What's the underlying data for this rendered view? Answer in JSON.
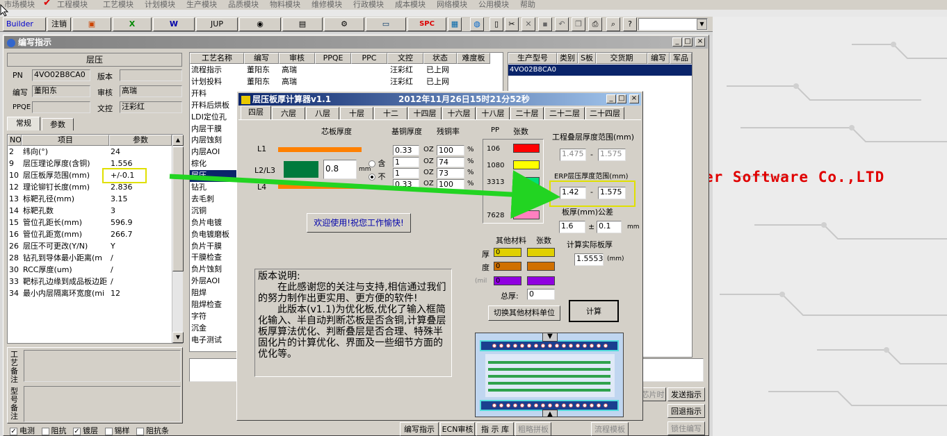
{
  "menu": [
    "市场模块",
    "工程模块",
    "工艺模块",
    "计划模块",
    "生产模块",
    "品质模块",
    "物料模块",
    "维修模块",
    "行政模块",
    "成本模块",
    "网络模块",
    "公用模块",
    "帮助"
  ],
  "toolbar": {
    "builder": "Builder",
    "logout": "注销",
    "jup": "JUP",
    "spc": "SPC"
  },
  "main_window": {
    "title": "编写指示"
  },
  "left_panel": {
    "header": "层压",
    "pn_label": "PN",
    "pn_value": "4VO02B8CA0",
    "version_label": "版本",
    "version_value": "",
    "author_label": "编写",
    "author_value": "董阳东",
    "reviewer_label": "审核",
    "reviewer_value": "高瑞",
    "ppqe_label": "PPQE",
    "ppqe_value": "",
    "control_label": "文控",
    "control_value": "汪彩红",
    "tabs": [
      "常规",
      "参数"
    ],
    "param_headers": [
      "NO",
      "项目",
      "参数"
    ],
    "params": [
      {
        "no": "2",
        "item": "纬向(°)",
        "value": "24"
      },
      {
        "no": "9",
        "item": "层压理论厚度(含铜)",
        "value": "1.556"
      },
      {
        "no": "10",
        "item": "层压板厚范围(mm)",
        "value": "+/-0.1"
      },
      {
        "no": "12",
        "item": "理论铆钉长度(mm)",
        "value": "2.836"
      },
      {
        "no": "13",
        "item": "标靶孔径(mm)",
        "value": "3.15"
      },
      {
        "no": "14",
        "item": "标靶孔数",
        "value": "3"
      },
      {
        "no": "15",
        "item": "管位孔距长(mm)",
        "value": "596.9"
      },
      {
        "no": "16",
        "item": "管位孔距宽(mm)",
        "value": "266.7"
      },
      {
        "no": "26",
        "item": "层压不可更改(Y/N)",
        "value": "Y"
      },
      {
        "no": "28",
        "item": "钻孔到导体最小距离(m",
        "value": "/"
      },
      {
        "no": "30",
        "item": "RCC厚度(um)",
        "value": "/"
      },
      {
        "no": "33",
        "item": "靶标孔边缘到成品板边距",
        "value": "/"
      },
      {
        "no": "34",
        "item": "最小内层隔离环宽度(mi",
        "value": "12"
      }
    ],
    "remark1": "工艺备注",
    "remark2": "型号备注",
    "checks": [
      {
        "label": "电测",
        "checked": true
      },
      {
        "label": "阻抗",
        "checked": false
      },
      {
        "label": "镀层",
        "checked": true
      },
      {
        "label": "锡样",
        "checked": false
      },
      {
        "label": "阻抗条",
        "checked": false
      }
    ]
  },
  "process_grid": {
    "headers": [
      "工艺名称",
      "编写",
      "审核",
      "PPQE",
      "PPC",
      "文控",
      "状态",
      "难度板"
    ],
    "rows": [
      {
        "name": "流程指示",
        "author": "董阳东",
        "reviewer": "高瑞",
        "ppqe": "",
        "ppc": "",
        "control": "汪彩红",
        "status": "已上网"
      },
      {
        "name": "计划投料",
        "author": "董阳东",
        "reviewer": "高瑞",
        "ppqe": "",
        "ppc": "",
        "control": "汪彩红",
        "status": "已上网"
      },
      {
        "name": "开料"
      },
      {
        "name": "开料后烘板"
      },
      {
        "name": "LDI定位孔"
      },
      {
        "name": "内层干膜"
      },
      {
        "name": "内层蚀刻"
      },
      {
        "name": "内层AOI"
      },
      {
        "name": "棕化"
      },
      {
        "name": "层压"
      },
      {
        "name": "钻孔"
      },
      {
        "name": "去毛刺"
      },
      {
        "name": "沉铜"
      },
      {
        "name": "负片电镀"
      },
      {
        "name": "负电镀磨板"
      },
      {
        "name": "负片干膜"
      },
      {
        "name": "干膜检查"
      },
      {
        "name": "负片蚀刻"
      },
      {
        "name": "外层AOI"
      },
      {
        "name": "阻焊"
      },
      {
        "name": "阻焊检查"
      },
      {
        "name": "字符"
      },
      {
        "name": "沉金"
      },
      {
        "name": "电子测试"
      }
    ]
  },
  "model_grid": {
    "headers": [
      "生产型号",
      "类别",
      "S板",
      "交货期",
      "编写",
      "军品"
    ],
    "rows": [
      {
        "model": "4VO02B8CA0"
      }
    ]
  },
  "right_buttons": [
    "发送指示",
    "回退指示",
    "锁住编写"
  ],
  "right_partial": "芯片时",
  "bottom_buttons": [
    "编写指示",
    "ECN审核",
    "指 示 库",
    "粗略拼板",
    "流程模板"
  ],
  "bg_text": "er Software Co.,LTD",
  "calc": {
    "title": "层压板厚计算器v1.1",
    "datetime": "2012年11月26日15时21分52秒",
    "tabs": [
      "四层",
      "六层",
      "八层",
      "十层",
      "十二",
      "十四层",
      "十六层",
      "十八层",
      "二十层",
      "二十二层",
      "二十四层"
    ],
    "col_core": "芯板厚度",
    "col_base": "基铜厚度",
    "col_residual": "残铜率",
    "col_pp": "PP",
    "col_sheets": "张数",
    "layer_labels": [
      "L1",
      "L2/L3",
      "L4"
    ],
    "core_value": "0.8",
    "core_unit": "mm",
    "radio_with": "含",
    "radio_without": "不",
    "copper": [
      {
        "base": "0.33",
        "unit": "OZ",
        "residual": "100",
        "pct": "%"
      },
      {
        "base": "1",
        "unit": "OZ",
        "residual": "74",
        "pct": "%"
      },
      {
        "base": "1",
        "unit": "OZ",
        "residual": "73",
        "pct": "%"
      },
      {
        "base": "0.33",
        "unit": "OZ",
        "residual": "100",
        "pct": "%"
      }
    ],
    "pp": [
      {
        "name": "106",
        "sheets": "",
        "color": "#ff0000"
      },
      {
        "name": "1080",
        "sheets": "",
        "color": "#ffff00"
      },
      {
        "name": "3313",
        "sheets": "2",
        "color": "#00e07a"
      },
      {
        "name": "",
        "sheets": "",
        "color": "#1aa3c4"
      },
      {
        "name": "7628",
        "sheets": "",
        "color": "#ff80c0"
      }
    ],
    "welcome": "欢迎使用!祝您工作愉快!",
    "eng_range_label": "工程叠层厚度范围(mm)",
    "eng_min": "1.475",
    "eng_max": "1.575",
    "erp_range_label": "ERP层压厚度范围(mm)",
    "erp_min": "1.42",
    "erp_max": "1.575",
    "thickness_label": "板厚(mm)公差",
    "thickness_value": "1.6",
    "tolerance_sign": "±",
    "tolerance_value": "0.1",
    "tolerance_unit": "mm",
    "actual_label": "计算实际板厚",
    "actual_value": "1.5553",
    "actual_unit": "(mm)",
    "other_label": "其他材料",
    "other_sheets_label": "张数",
    "other_side": [
      "厚",
      "度",
      "(mil"
    ],
    "other": [
      {
        "value": "0",
        "color": "#e0d000"
      },
      {
        "value": "0",
        "color": "#d07000"
      },
      {
        "value": "0",
        "color": "#9000e0"
      }
    ],
    "total_label": "总厚:",
    "total_value": "0",
    "switch_btn": "切换其他材料单位",
    "calc_btn": "计算",
    "dash": "-",
    "note_title": "版本说明:",
    "note_p1": "在此感谢您的关注与支持,相信通过我们的努力制作出更实用、更方便的软件!",
    "note_p2": "此版本(v1.1)为优化板,优化了输入框简化输入、半自动判断芯板是否含铜,计算叠层板厚算法优化、判断叠层是否合理、特殊半固化片的计算优化、界面及一些细节方面的优化等。"
  },
  "colors": {
    "accent_title": "#0a246a",
    "highlight_box": "#e0e000",
    "arrow": "#22d422",
    "bg_text": "#e00000"
  }
}
